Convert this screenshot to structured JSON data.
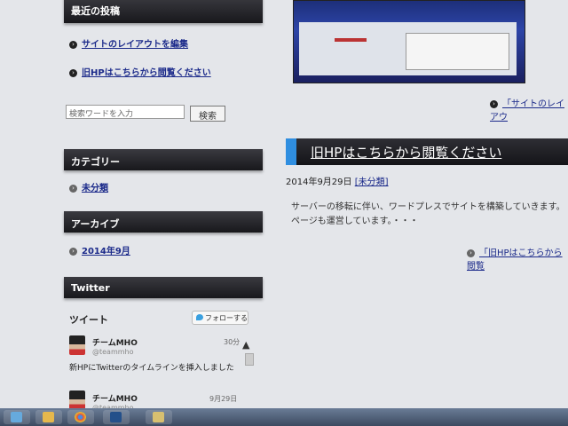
{
  "sidebar": {
    "recent_title": "最近の投稿",
    "recent_posts": [
      {
        "label": "サイトのレイアウトを編集"
      },
      {
        "label": "旧HPはこちらから閲覧ください"
      }
    ],
    "search": {
      "placeholder": "検索ワードを入力",
      "button": "検索"
    },
    "categories_title": "カテゴリー",
    "category": "未分類",
    "archive_title": "アーカイブ",
    "archive": "2014年9月",
    "twitter_title": "Twitter",
    "twitter": {
      "tweets_label": "ツイート",
      "follow_button": "フォローする",
      "tweets": [
        {
          "name": "チームMHO",
          "handle": "@teammho",
          "time": "30分",
          "text": "新HPにTwitterのタイムラインを挿入しました"
        },
        {
          "name": "チームMHO",
          "handle": "@teammho",
          "time": "9月29日"
        }
      ]
    }
  },
  "main": {
    "prev_post_link": "「サイトのレイアウ",
    "post": {
      "title": "旧HPはこちらから閲覧ください",
      "date": "2014年9月29日",
      "category": "[未分類]",
      "body_line1": "サーバーの移転に伴い、ワードプレスでサイトを構築していきます。",
      "body_line2": "ページも運営しています。・・・",
      "more_link": "「旧HPはこちらから閲覧"
    }
  },
  "colors": {
    "accent": "#2f8ee0",
    "link": "#1b2a8a",
    "bar": "#1a1a1e"
  }
}
